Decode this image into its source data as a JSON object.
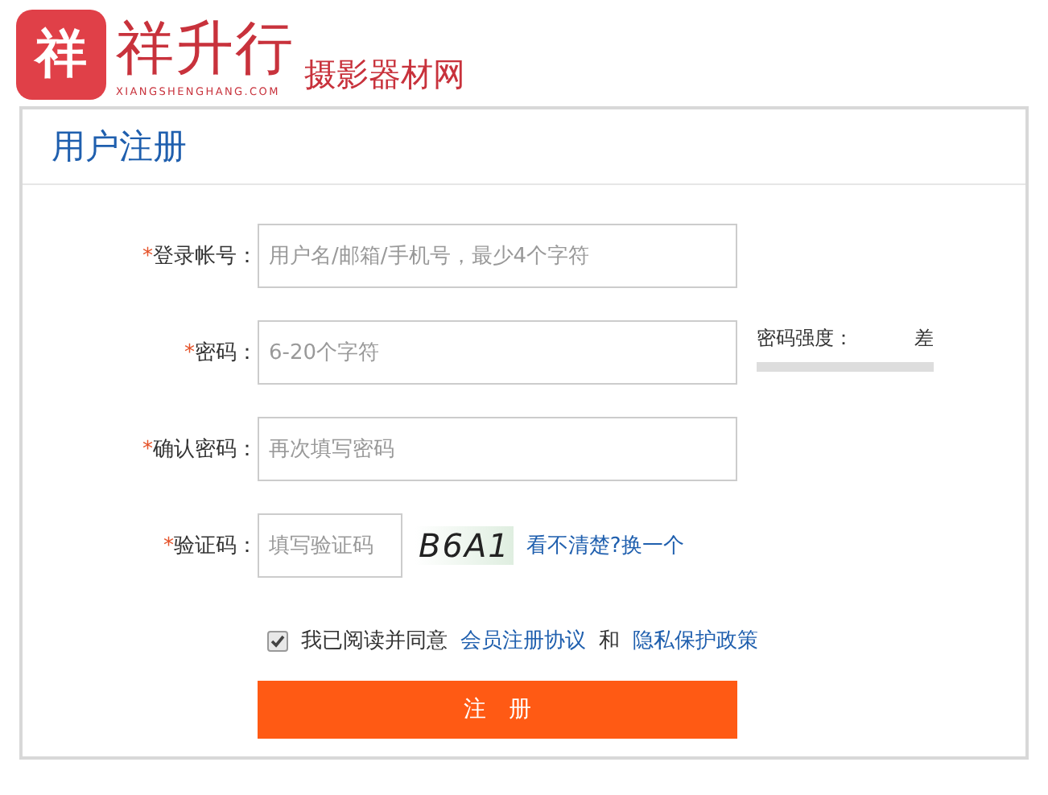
{
  "logo": {
    "badge": "祥",
    "name": "祥升行",
    "domain": "XIANGSHENGHANG.COM",
    "tagline": "摄影器材网"
  },
  "panel": {
    "title": "用户注册"
  },
  "fields": [
    {
      "kind": "text",
      "mark": "*",
      "label": "登录帐号：",
      "placeholder": "用户名/邮箱/手机号，最少4个字符"
    },
    {
      "kind": "password",
      "mark": "*",
      "label": "密码：",
      "placeholder": "6-20个字符",
      "strength": {
        "label": "密码强度：",
        "value": "差"
      }
    },
    {
      "kind": "password",
      "mark": "*",
      "label": "确认密码：",
      "placeholder": "再次填写密码"
    },
    {
      "kind": "captcha",
      "mark": "*",
      "label": "验证码：",
      "placeholder": "填写验证码",
      "captcha": "B6A1",
      "refresh": "看不清楚?换一个"
    }
  ],
  "agree": {
    "checked": true,
    "text": "我已阅读并同意",
    "link1": "会员注册协议",
    "and": "和",
    "link2": "隐私保护政策"
  },
  "submit": "注　册"
}
